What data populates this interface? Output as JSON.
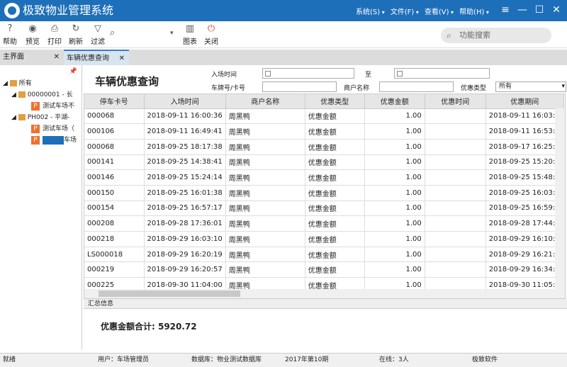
{
  "app": {
    "title": "极致物业管理系统",
    "menu": [
      "系统(S)",
      "文件(F)",
      "查看(V)",
      "帮助(H)"
    ]
  },
  "toolbar": {
    "help": "帮助",
    "preview": "预览",
    "print": "打印",
    "refresh": "刷新",
    "filter": "过滤",
    "chart": "图表",
    "close": "关闭",
    "search_placeholder": "功能搜索"
  },
  "tabs": [
    {
      "label": "主界面"
    },
    {
      "label": "车辆优惠查询"
    }
  ],
  "tree": {
    "root": "所有",
    "lot1": "00000001 - 长",
    "lot1_child": "测试车场不",
    "lot2": "PH002 - 平湖-",
    "lot2_child1": "测试车场（",
    "lot2_child2": "车场"
  },
  "page": {
    "title": "车辆优惠查询",
    "entry_time_label": "入场时间",
    "to_label": "至",
    "plate_label": "车牌号/卡号",
    "merchant_label": "商户名称",
    "discount_type_label": "优惠类型",
    "discount_type_value": "所有"
  },
  "table": {
    "headers": [
      "停车卡号",
      "入场时间",
      "商户名称",
      "优惠类型",
      "优惠金额",
      "优惠时间",
      "优惠期间"
    ],
    "rows": [
      [
        "000068",
        "2018-09-11 16:00:36",
        "周黑鸭",
        "优惠金额",
        "1.00",
        "",
        "2018-09-11 16:03:0"
      ],
      [
        "000106",
        "2018-09-11 16:49:41",
        "周黑鸭",
        "优惠金额",
        "1.00",
        "",
        "2018-09-11 16:53:3"
      ],
      [
        "000068",
        "2018-09-25 18:17:38",
        "周黑鸭",
        "优惠金额",
        "1.00",
        "",
        "2018-09-17 16:25:5"
      ],
      [
        "000141",
        "2018-09-25 14:38:41",
        "周黑鸭",
        "优惠金额",
        "1.00",
        "",
        "2018-09-25 15:20:5"
      ],
      [
        "000146",
        "2018-09-25 15:24:14",
        "周黑鸭",
        "优惠金额",
        "1.00",
        "",
        "2018-09-25 15:48:1"
      ],
      [
        "000150",
        "2018-09-25 16:01:38",
        "周黑鸭",
        "优惠金额",
        "1.00",
        "",
        "2018-09-25 16:03:0"
      ],
      [
        "000154",
        "2018-09-25 16:57:17",
        "周黑鸭",
        "优惠金额",
        "1.00",
        "",
        "2018-09-25 16:59:0"
      ],
      [
        "000208",
        "2018-09-28 17:36:01",
        "周黑鸭",
        "优惠金额",
        "1.00",
        "",
        "2018-09-28 17:44:4"
      ],
      [
        "000218",
        "2018-09-29 16:03:10",
        "周黑鸭",
        "优惠金额",
        "1.00",
        "",
        "2018-09-29 16:10:5"
      ],
      [
        "LS000018",
        "2018-09-29 16:20:19",
        "周黑鸭",
        "优惠金额",
        "1.00",
        "",
        "2018-09-29 16:21:3"
      ],
      [
        "000219",
        "2018-09-29 16:20:57",
        "周黑鸭",
        "优惠金额",
        "1.00",
        "",
        "2018-09-29 16:34:3"
      ],
      [
        "000225",
        "2018-09-30 11:04:00",
        "周黑鸭",
        "优惠金额",
        "1.00",
        "",
        "2018-09-30 11:05:2"
      ]
    ]
  },
  "summary": {
    "header": "汇总信息",
    "total": "优惠金额合计: 5920.72"
  },
  "status": {
    "ready": "就绪",
    "user": "用户：车场管理员",
    "database": "数据库：物业测试数据库",
    "period": "2017年第10期",
    "online": "在线：3人",
    "vendor": "极致软件"
  }
}
